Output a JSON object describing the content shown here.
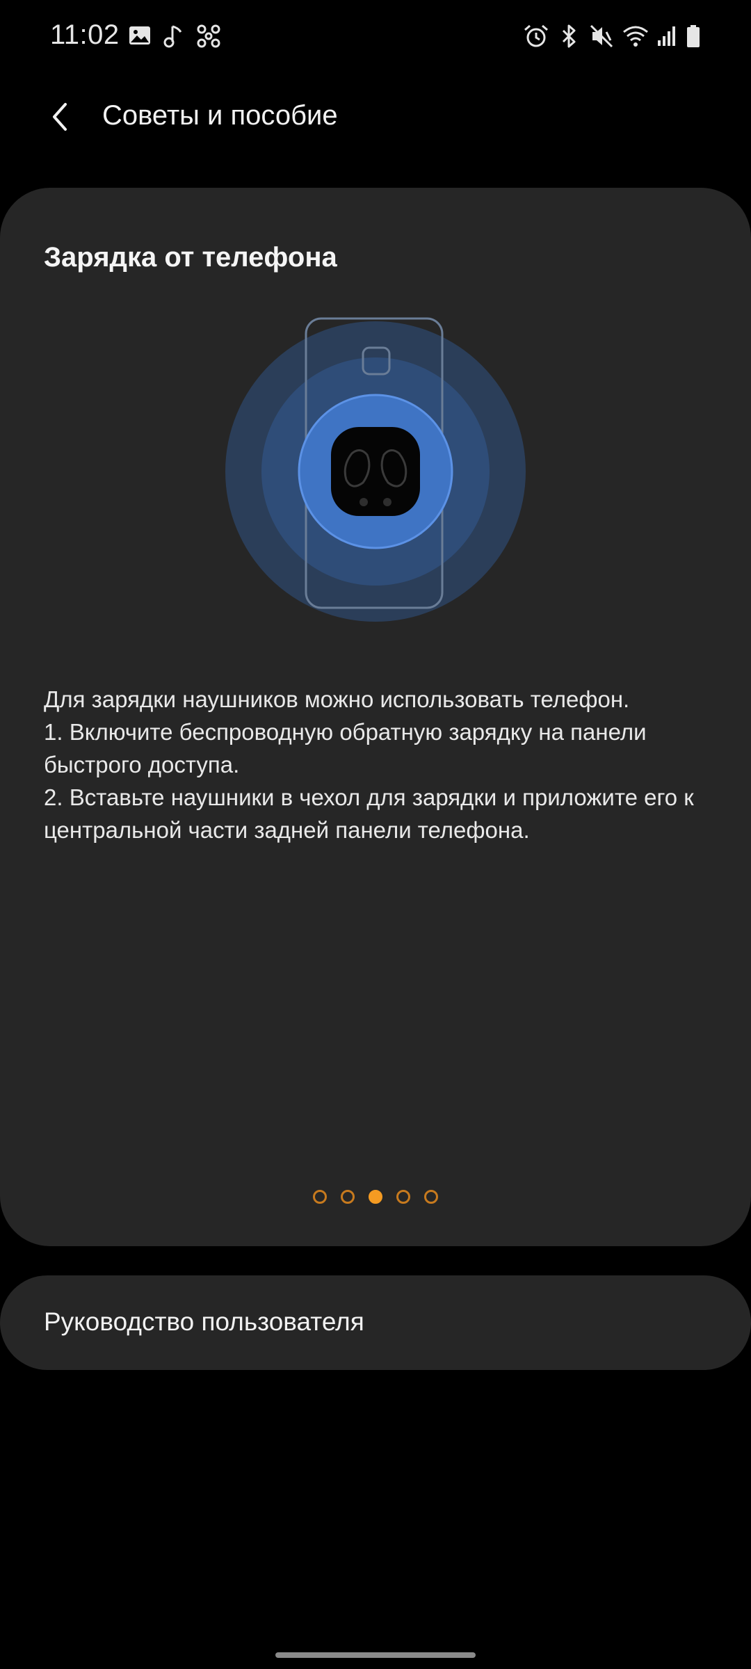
{
  "status_bar": {
    "time": "11:02",
    "left_icons": [
      "image-icon",
      "music-note-icon",
      "fan-icon"
    ],
    "right_icons": [
      "alarm-icon",
      "bluetooth-icon",
      "mute-icon",
      "wifi-icon",
      "signal-icon",
      "battery-icon"
    ]
  },
  "header": {
    "back_icon": "chevron-left-icon",
    "title": "Советы и пособие"
  },
  "tip": {
    "title": "Зарядка от телефона",
    "lines": [
      "Для зарядки наушников можно использовать телефон.",
      "1. Включите беспроводную обратную зарядку на панели быстрого доступа.",
      "2. Вставьте наушники в чехол для зарядки и приложите его к центральной части задней панели телефона."
    ],
    "pager": {
      "total": 5,
      "current": 3
    }
  },
  "guide": {
    "label": "Руководство пользователя"
  },
  "colors": {
    "background": "#000000",
    "card": "#262626",
    "accent": "#f59b22",
    "wave": "#3a6fbf"
  }
}
